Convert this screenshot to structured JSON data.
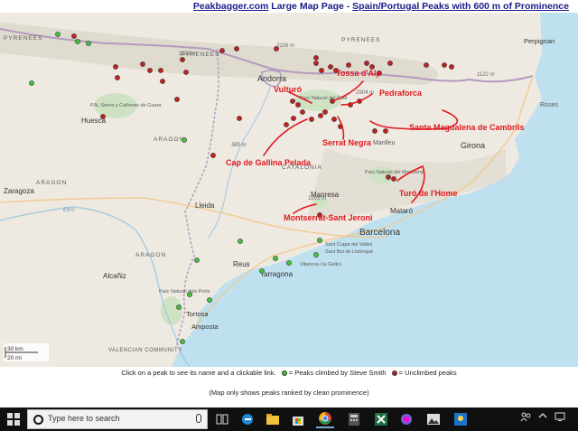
{
  "header": {
    "site": "Peakbagger.com",
    "middle": " Large Map Page - ",
    "list_link": "Spain/Portugal Peaks with 600 m of Prominence"
  },
  "map": {
    "colors": {
      "land": "#eeeae2",
      "sea": "#bfe0ee",
      "green_park": "#cfe2c4",
      "climbed": "#45c23a",
      "unclimbed": "#c0201f",
      "annotation": "#e0191f",
      "border": "#b59ac0"
    },
    "place_labels": [
      {
        "id": "pyrenees-w",
        "text": "PYRENEES"
      },
      {
        "id": "pyrenees-e",
        "text": "PYRENEES"
      },
      {
        "id": "pyrenees-c",
        "text": "PYRENEES"
      },
      {
        "id": "andorra",
        "text": "Andorra"
      },
      {
        "id": "perpignan",
        "text": "Perpignan"
      },
      {
        "id": "huesca",
        "text": "Huesca"
      },
      {
        "id": "aragon-1",
        "text": "ARAGON"
      },
      {
        "id": "aragon-2",
        "text": "ARAGON"
      },
      {
        "id": "aragon-3",
        "text": "ARAGON"
      },
      {
        "id": "catalonia",
        "text": "CATALONIA"
      },
      {
        "id": "zaragoza",
        "text": "Zaragoza"
      },
      {
        "id": "lleida",
        "text": "Lleida"
      },
      {
        "id": "manresa",
        "text": "Manresa"
      },
      {
        "id": "girona",
        "text": "Girona"
      },
      {
        "id": "manlleu",
        "text": "Manlleu"
      },
      {
        "id": "mataro",
        "text": "Mataró"
      },
      {
        "id": "barcelona",
        "text": "Barcelona"
      },
      {
        "id": "reus",
        "text": "Reus"
      },
      {
        "id": "tarragona",
        "text": "Tarragona"
      },
      {
        "id": "alcaniz",
        "text": "Alcañiz"
      },
      {
        "id": "tortosa",
        "text": "Tortosa"
      },
      {
        "id": "amposta",
        "text": "Amposta"
      },
      {
        "id": "valencian-community",
        "text": "VALENCIAN COMMUNITY"
      },
      {
        "id": "roses",
        "text": "Roses"
      },
      {
        "id": "ebro",
        "text": "Ebro"
      },
      {
        "id": "sant-cugat",
        "text": "Sant Cugat del Vallès"
      },
      {
        "id": "sant-boi",
        "text": "Sant Boi de Llobregat"
      },
      {
        "id": "vilanova",
        "text": "Vilanova i la Geltrú"
      },
      {
        "id": "sierra-guara",
        "text": "P.N. Sierra y Cañones de Guara"
      },
      {
        "id": "cadi",
        "text": "Parc Natural del Cadí"
      },
      {
        "id": "montseny",
        "text": "Parc Natural del Montseny"
      },
      {
        "id": "ports",
        "text": "Parc Natural dels Ports"
      }
    ],
    "elevations": [
      {
        "id": "e-aneto",
        "text": "3323 m"
      },
      {
        "id": "e-pyr",
        "text": "3106 m"
      },
      {
        "id": "e-canigo",
        "text": "1122 m"
      },
      {
        "id": "e-pedraforca",
        "text": "2904 m"
      },
      {
        "id": "e-montsec",
        "text": "385 m"
      },
      {
        "id": "e-montserrat",
        "text": "1203 m"
      }
    ],
    "annotations": [
      {
        "id": "tossa-dalp",
        "text": "Tossa  d'Alp"
      },
      {
        "id": "vulturo",
        "text": "Vulturó"
      },
      {
        "id": "pedraforca",
        "text": "Pedraforca"
      },
      {
        "id": "santa-magdalena",
        "text": "Santa Magdalena de Cambrils"
      },
      {
        "id": "serrat-negra",
        "text": "Serrat Negra"
      },
      {
        "id": "cap-de-gallina-pelada",
        "text": "Cap de Gallina Pelada"
      },
      {
        "id": "turo-de-lhome",
        "text": "Turó de l'Home"
      },
      {
        "id": "montserrat-sant-jeroni",
        "text": "Montserrat-Sant Jeroni"
      }
    ],
    "scale": {
      "km": "30 km",
      "mi": "20 mi"
    }
  },
  "footer": {
    "instruction": "Click on a peak to see its name and a clickable link.",
    "legend_climbed": "= Peaks climbed by Steve Smith",
    "legend_unclimbed": "= Unclimbed peaks",
    "note": "(Map only shows peaks ranked by clean prominence)"
  },
  "taskbar": {
    "search_placeholder": "Type here to search",
    "icons": [
      "task-view",
      "edge",
      "file-explorer",
      "store",
      "chrome",
      "calculator",
      "excel",
      "photos",
      "image-viewer",
      "weather"
    ]
  }
}
